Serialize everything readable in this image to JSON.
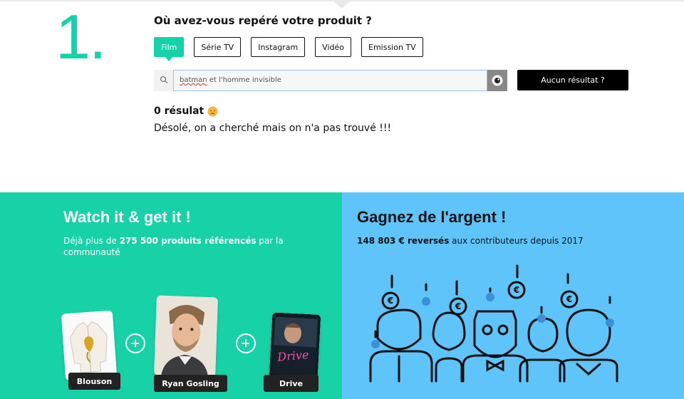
{
  "step": {
    "number": "1."
  },
  "search_section": {
    "question": "Où avez-vous repéré votre produit ?",
    "tabs": [
      {
        "label": "Film",
        "active": true
      },
      {
        "label": "Série TV",
        "active": false
      },
      {
        "label": "Instagram",
        "active": false
      },
      {
        "label": "Vidéo",
        "active": false
      },
      {
        "label": "Emission TV",
        "active": false
      }
    ],
    "search": {
      "value_word1": "batman",
      "value_rest": " et l'homme invisible",
      "search_icon": "search-icon",
      "scan_icon": "eye-scan-icon"
    },
    "no_result_button": "Aucun résultat ?",
    "result_count": "0 résulat",
    "result_emoji": "sad-face-icon",
    "result_message": "Désolé, on a cherché mais on n'a pas trouvé !!!"
  },
  "left_panel": {
    "title": "Watch it & get it !",
    "sub_pre": "Déjà plus de ",
    "sub_bold": "275 500 produits référencés",
    "sub_post": " par la communauté",
    "cards": [
      {
        "label": "Blouson"
      },
      {
        "label": "Ryan Gosling"
      },
      {
        "label": "Drive"
      }
    ],
    "poster_title": "Drive",
    "bg_color": "#16d2a6"
  },
  "right_panel": {
    "title": "Gagnez de l'argent !",
    "sub_bold": "148 803 € reversés",
    "sub_post": " aux contributeurs depuis 2017",
    "coin_symbol": "€",
    "bg_color": "#5ec4fa"
  },
  "colors": {
    "accent": "#14d3aa",
    "dark": "#111111"
  }
}
